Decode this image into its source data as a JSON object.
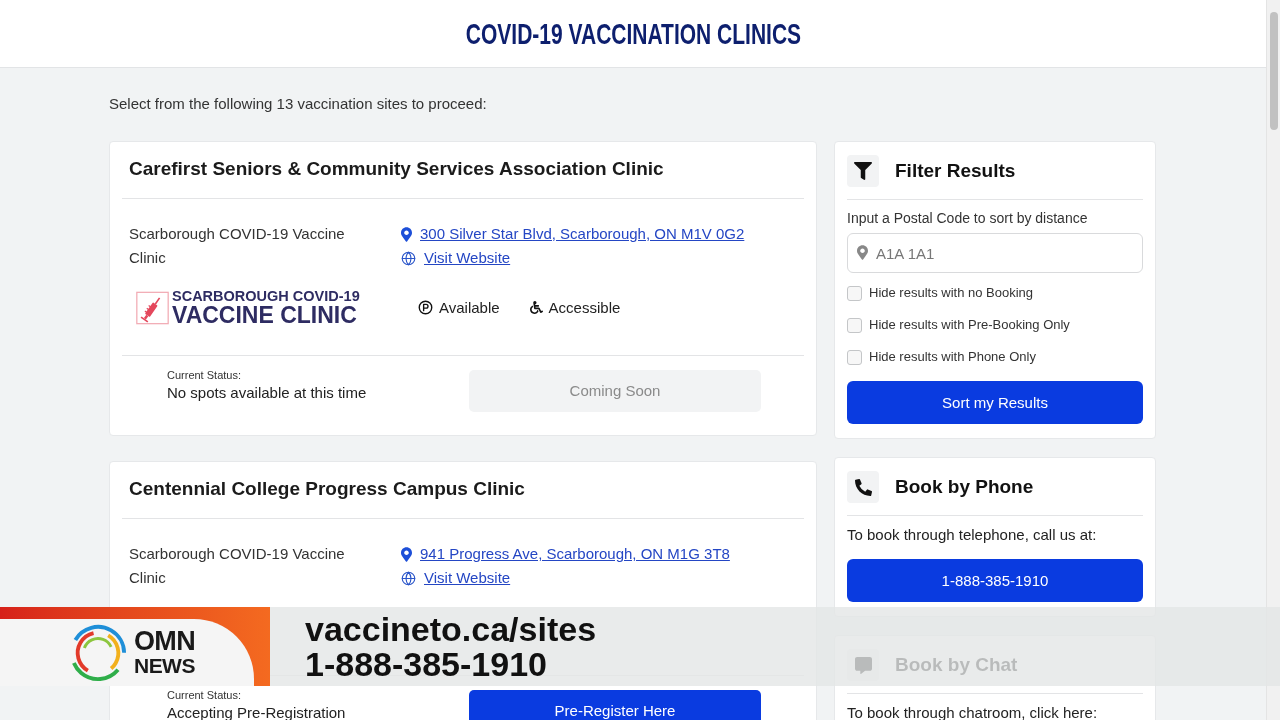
{
  "header": {
    "title": "COVID-19 VACCINATION CLINICS"
  },
  "intro": "Select from the following 13 vaccination sites to proceed:",
  "clinics": [
    {
      "name": "Carefirst Seniors & Community Services Association Clinic",
      "organization": "Scarborough COVID-19 Vaccine Clinic",
      "address": "300 Silver Star Blvd, Scarborough, ON M1V 0G2",
      "website": "Visit Website",
      "logo": {
        "line_1": "SCARBOROUGH COVID-19",
        "line_2": "VACCINE CLINIC"
      },
      "amenities": [
        {
          "kind": "parking",
          "label": "Available"
        },
        {
          "kind": "accessible",
          "label": "Accessible"
        }
      ],
      "status_label": "Current Status:",
      "status": "No spots available at this time",
      "action": {
        "label": "Coming Soon",
        "disabled": true
      }
    },
    {
      "name": "Centennial College Progress Campus Clinic",
      "organization": "Scarborough COVID-19 Vaccine Clinic",
      "address": "941 Progress Ave, Scarborough, ON M1G 3T8",
      "website": "Visit Website",
      "status_label": "Current Status:",
      "status": "Accepting Pre-Registration",
      "action": {
        "label": "Pre-Register Here",
        "disabled": false
      }
    }
  ],
  "filter_panel": {
    "title": "Filter Results",
    "postal_label": "Input a Postal Code to sort by distance",
    "postal_field": {
      "placeholder": "A1A 1A1"
    },
    "options": [
      {
        "label": "Hide results with no Booking",
        "checked": false
      },
      {
        "label": "Hide results with Pre-Booking Only",
        "checked": false
      },
      {
        "label": "Hide results with Phone Only",
        "checked": false
      }
    ],
    "button": "Sort my Results"
  },
  "phone_panel": {
    "title": "Book by Phone",
    "text": "To book through telephone, call us at:",
    "button": "1-888-385-1910"
  },
  "chat_panel": {
    "title": "Book by Chat",
    "text": "To book through chatroom, click here:"
  },
  "news_banner": {
    "logo": {
      "line_1": "OMN",
      "line_2": "NEWS"
    },
    "website": "vaccineto.ca/sites",
    "phone": "1-888-385-1910"
  }
}
